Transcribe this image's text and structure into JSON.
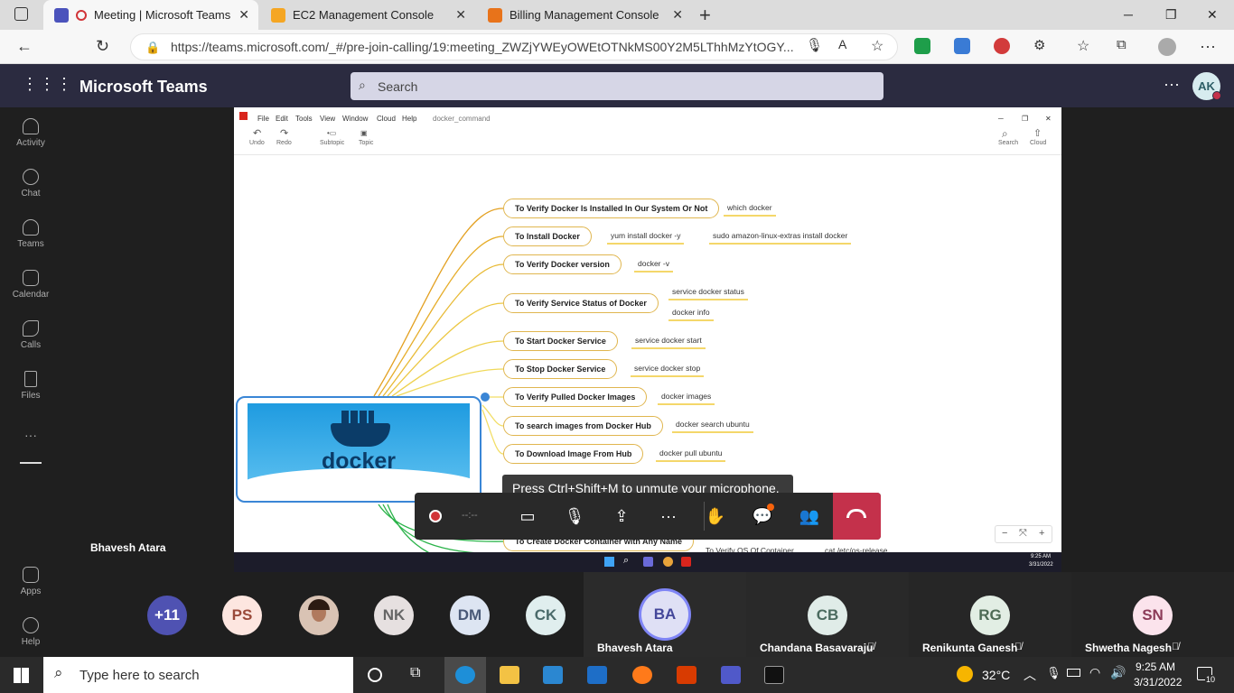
{
  "browser": {
    "tabs": [
      {
        "title": "Meeting | Microsoft Teams",
        "color": "#4b53bc"
      },
      {
        "title": "EC2 Management Console",
        "color": "#f5a623"
      },
      {
        "title": "Billing Management Console",
        "color": "#e8731a"
      }
    ],
    "new_tab": "+",
    "url": "https://teams.microsoft.com/_#/pre-join-calling/19:meeting_ZWZjYWEyOWEtOTNkMS00Y2M5LThhMzYtOGY..."
  },
  "teams": {
    "app_title": "Microsoft Teams",
    "search_placeholder": "Search",
    "more": "···",
    "user_initials": "AK",
    "rail": [
      {
        "label": "Activity",
        "icon": "bell-icon"
      },
      {
        "label": "Chat",
        "icon": "chat-icon"
      },
      {
        "label": "Teams",
        "icon": "teams-icon"
      },
      {
        "label": "Calendar",
        "icon": "calendar-icon"
      },
      {
        "label": "Calls",
        "icon": "phone-icon"
      },
      {
        "label": "Files",
        "icon": "file-icon"
      }
    ],
    "rail_more": "···",
    "rail_bottom": [
      {
        "label": "Apps",
        "icon": "apps-icon"
      },
      {
        "label": "Help",
        "icon": "help-icon"
      }
    ]
  },
  "meeting": {
    "presenter_label": "Bhavesh Atara",
    "toast": "Press Ctrl+Shift+M to unmute your microphone.",
    "timer": "--:--",
    "participants": [
      {
        "initials": "+11",
        "bg": "#4f52b2",
        "fg": "#ffffff",
        "name": ""
      },
      {
        "initials": "PS",
        "bg": "#fde6e0",
        "fg": "#9a4a3a",
        "name": ""
      },
      {
        "initials": "",
        "bg": "#d9c3b4",
        "fg": "#333333",
        "name": ""
      },
      {
        "initials": "NK",
        "bg": "#e6e0e0",
        "fg": "#666666",
        "name": ""
      },
      {
        "initials": "DM",
        "bg": "#dde5f2",
        "fg": "#4a5a78",
        "name": ""
      },
      {
        "initials": "CK",
        "bg": "#e0eeee",
        "fg": "#4a6a6a",
        "name": ""
      },
      {
        "initials": "BA",
        "bg": "#dfe0f5",
        "fg": "#44479a",
        "name": "Bhavesh Atara"
      },
      {
        "initials": "CB",
        "bg": "#e0ece8",
        "fg": "#4b6b5f",
        "name": "Chandana Basavaraju"
      },
      {
        "initials": "RG",
        "bg": "#e2eee4",
        "fg": "#4e6b55",
        "name": "Renikunta Ganesh"
      },
      {
        "initials": "SN",
        "bg": "#fbe3ec",
        "fg": "#8c3b58",
        "name": "Shwetha Nagesh"
      }
    ]
  },
  "xmind": {
    "menu": [
      "File",
      "Edit",
      "Tools",
      "View",
      "Window",
      "Cloud",
      "Help"
    ],
    "doc_name": "docker_command",
    "toolbar": [
      "Undo",
      "Redo",
      "Subtopic",
      "Topic"
    ],
    "toolbar_right": [
      "Search",
      "Cloud"
    ],
    "central_topic": "docker",
    "topics": [
      {
        "label": "To Verify Docker Is Installed In Our System Or Not",
        "leaves": [
          "which docker"
        ]
      },
      {
        "label": "To Install Docker",
        "leaves": [
          "yum install docker -y",
          "sudo amazon-linux-extras install docker"
        ]
      },
      {
        "label": "To Verify Docker version",
        "leaves": [
          "docker -v"
        ]
      },
      {
        "label": "To Verify Service Status of Docker",
        "leaves": [
          "service docker status",
          "docker info"
        ]
      },
      {
        "label": "To Start Docker Service",
        "leaves": [
          "service docker start"
        ]
      },
      {
        "label": "To Stop Docker Service",
        "leaves": [
          "service docker stop"
        ]
      },
      {
        "label": "To Verify Pulled Docker Images",
        "leaves": [
          "docker images"
        ]
      },
      {
        "label": "To search images from Docker Hub",
        "leaves": [
          "docker search ubuntu"
        ]
      },
      {
        "label": "To Download Image From Hub",
        "leaves": [
          "docker pull ubuntu"
        ]
      },
      {
        "label": "To Create Docker Container with Any Name",
        "leaves": [
          "To Verify OS Of Container",
          "cat /etc/os-release"
        ]
      }
    ],
    "remote_time": "9:25 AM",
    "remote_date": "3/31/2022"
  },
  "taskbar": {
    "search_placeholder": "Type here to search",
    "weather": "32°C",
    "time": "9:25 AM",
    "date": "3/31/2022",
    "notifications": "10"
  }
}
